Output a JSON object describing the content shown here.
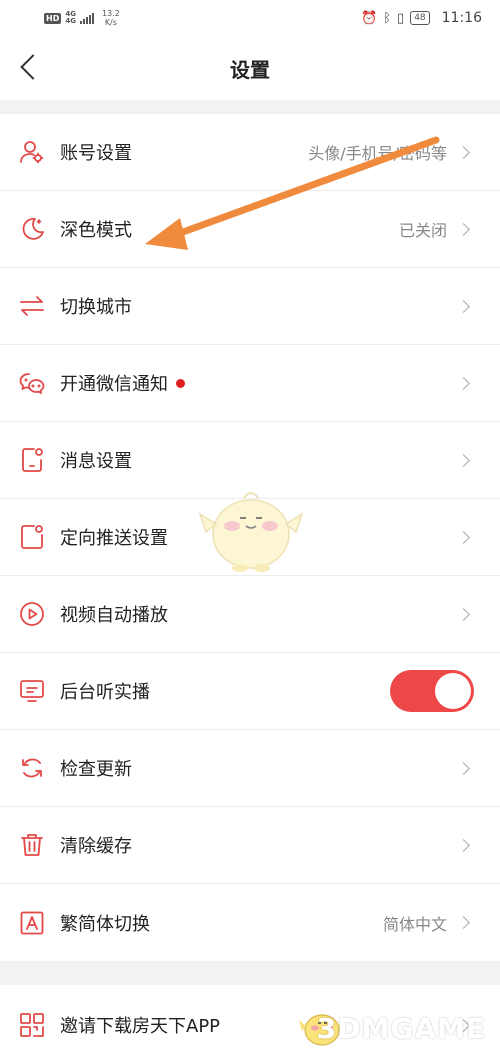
{
  "status_bar": {
    "hd": "HD",
    "network_top": "4G",
    "network_bottom": "4G",
    "speed_value": "13.2",
    "speed_unit": "K/s",
    "battery": "48",
    "time": "11:16"
  },
  "header": {
    "title": "设置"
  },
  "settings": {
    "items": [
      {
        "icon": "user-gear-icon",
        "label": "账号设置",
        "value": "头像/手机号/密码等"
      },
      {
        "icon": "moon-icon",
        "label": "深色模式",
        "value": "已关闭"
      },
      {
        "icon": "swap-arrows-icon",
        "label": "切换城市",
        "value": ""
      },
      {
        "icon": "wechat-icon",
        "label": "开通微信通知",
        "value": "",
        "badge": true
      },
      {
        "icon": "message-settings-icon",
        "label": "消息设置",
        "value": ""
      },
      {
        "icon": "targeted-push-icon",
        "label": "定向推送设置",
        "value": ""
      },
      {
        "icon": "play-circle-icon",
        "label": "视频自动播放",
        "value": ""
      },
      {
        "icon": "monitor-icon",
        "label": "后台听实播",
        "value": "",
        "toggle": "on"
      },
      {
        "icon": "refresh-icon",
        "label": "检查更新",
        "value": ""
      },
      {
        "icon": "trash-icon",
        "label": "清除缓存",
        "value": ""
      },
      {
        "icon": "font-a-icon",
        "label": "繁简体切换",
        "value": "简体中文"
      }
    ],
    "extra_items": [
      {
        "icon": "qr-code-icon",
        "label": "邀请下载房天下APP",
        "value": ""
      }
    ]
  },
  "colors": {
    "accent": "#e24a48",
    "toggle_on": "#ee4747",
    "arrow": "#f08a3c"
  },
  "watermark": {
    "text": "3DMGAME"
  }
}
